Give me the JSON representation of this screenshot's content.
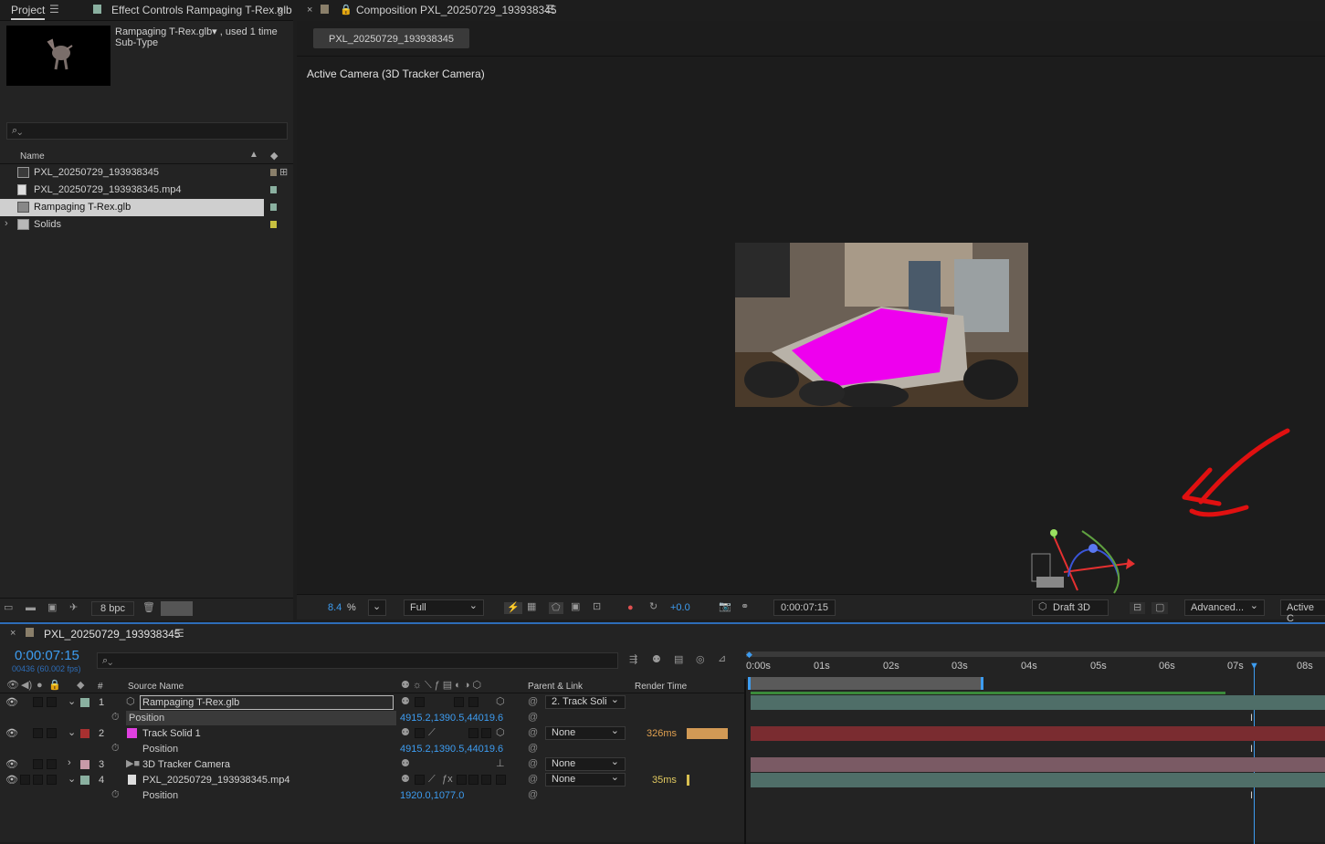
{
  "project": {
    "tab_project": "Project",
    "tab_effect": "Effect Controls Rampaging T-Rex.glb",
    "preview_name": "Rampaging T-Rex.glb▾ , used 1 time",
    "preview_sub": "Sub-Type",
    "col_name": "Name",
    "items": [
      {
        "name": "PXL_20250729_193938345",
        "type": "composition",
        "label_color": "#8a7f6a"
      },
      {
        "name": "PXL_20250729_193938345.mp4",
        "type": "footage",
        "label_color": "#8ab0a0"
      },
      {
        "name": "Rampaging T-Rex.glb",
        "type": "3d-model",
        "label_color": "#8ab0a0",
        "selected": true
      },
      {
        "name": "Solids",
        "type": "folder",
        "label_color": "#c8c040"
      }
    ],
    "bpc": "8 bpc"
  },
  "comp": {
    "tab_title": "Composition PXL_20250729_193938345",
    "breadcrumb": "PXL_20250729_193938345",
    "camera_label": "Active Camera (3D Tracker Camera)",
    "zoom": "8.4",
    "zoom_unit": "%",
    "resolution": "Full",
    "exposure": "+0.0",
    "timecode": "0:00:07:15",
    "renderer": "Draft 3D",
    "advanced": "Advanced...",
    "active_cam": "Active C"
  },
  "timeline": {
    "comp_name": "PXL_20250729_193938345",
    "time": "0:00:07:15",
    "frames": "00436 (60.002 fps)",
    "col_num": "#",
    "col_source": "Source Name",
    "col_parent": "Parent & Link",
    "col_render": "Render Time",
    "ruler": [
      "0:00s",
      "01s",
      "02s",
      "03s",
      "04s",
      "05s",
      "06s",
      "07s",
      "08s"
    ],
    "layers": [
      {
        "num": "1",
        "name": "Rampaging T-Rex.glb",
        "color": "#8ab0a0",
        "parent": "2. Track Soli",
        "render": "",
        "prop": "Position",
        "value": "4915.2,1390.5,44019.6",
        "track_color": "#4f6e68"
      },
      {
        "num": "2",
        "name": "Track Solid 1",
        "color": "#a83030",
        "parent": "None",
        "render": "326ms",
        "prop": "Position",
        "value": "4915.2,1390.5,44019.6",
        "track_color": "#7a2c30"
      },
      {
        "num": "3",
        "name": "3D Tracker Camera",
        "color": "#c89aa8",
        "parent": "None",
        "render": "",
        "track_color": "#7a5a64"
      },
      {
        "num": "4",
        "name": "PXL_20250729_193938345.mp4",
        "color": "#8ab0a0",
        "parent": "None",
        "render": "35ms",
        "prop": "Position",
        "value": "1920.0,1077.0",
        "track_color": "#4f6e68"
      }
    ]
  }
}
